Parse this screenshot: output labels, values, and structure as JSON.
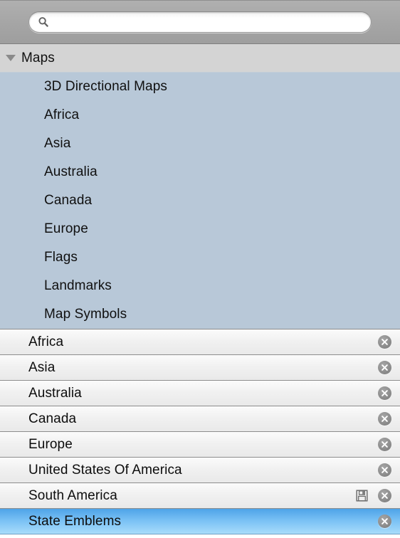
{
  "toolbar": {
    "search": {
      "value": "",
      "placeholder": "",
      "icon": "search-icon"
    }
  },
  "tree": {
    "header": {
      "label": "Maps",
      "expanded": true,
      "disclosure_icon": "triangle-down-icon"
    },
    "items": [
      {
        "label": "3D Directional Maps"
      },
      {
        "label": "Africa"
      },
      {
        "label": "Asia"
      },
      {
        "label": "Australia"
      },
      {
        "label": "Canada"
      },
      {
        "label": "Europe"
      },
      {
        "label": "Flags"
      },
      {
        "label": "Landmarks"
      },
      {
        "label": "Map Symbols"
      }
    ]
  },
  "list": {
    "rows": [
      {
        "label": "Africa",
        "selected": false,
        "has_save": false,
        "delete_icon": "close-circle-icon"
      },
      {
        "label": "Asia",
        "selected": false,
        "has_save": false,
        "delete_icon": "close-circle-icon"
      },
      {
        "label": "Australia",
        "selected": false,
        "has_save": false,
        "delete_icon": "close-circle-icon"
      },
      {
        "label": "Canada",
        "selected": false,
        "has_save": false,
        "delete_icon": "close-circle-icon"
      },
      {
        "label": "Europe",
        "selected": false,
        "has_save": false,
        "delete_icon": "close-circle-icon"
      },
      {
        "label": "United States Of America",
        "selected": false,
        "has_save": false,
        "delete_icon": "close-circle-icon"
      },
      {
        "label": "South America",
        "selected": false,
        "has_save": true,
        "save_icon": "save-disk-icon",
        "delete_icon": "close-circle-icon"
      },
      {
        "label": "State Emblems",
        "selected": true,
        "has_save": false,
        "delete_icon": "close-circle-icon"
      }
    ]
  },
  "colors": {
    "toolbar_bg": "#a6a6a6",
    "tree_header_bg": "#d4d4d4",
    "tree_bg": "#b8c8d8",
    "row_bg": "#f1f1f1",
    "selected_row_accent": "#4ea3e8",
    "delete_button": "#8c8c8c"
  }
}
